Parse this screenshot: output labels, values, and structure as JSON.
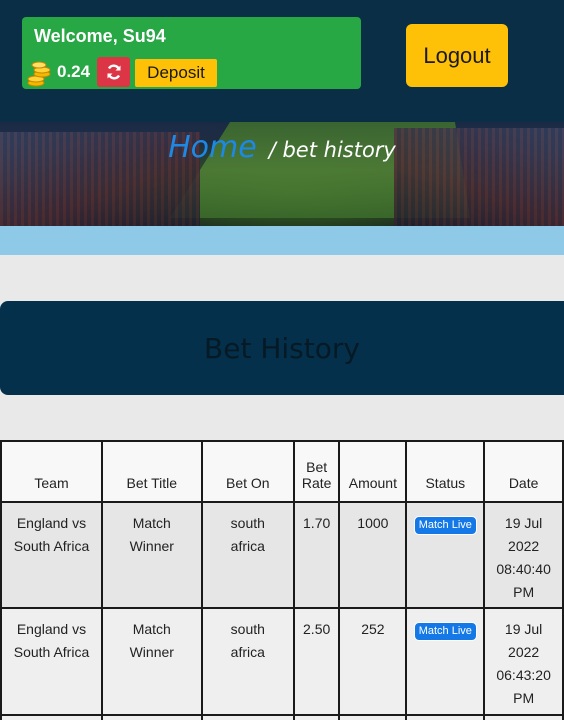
{
  "header": {
    "welcome": "Welcome, Su94",
    "balance": "0.24",
    "deposit_label": "Deposit",
    "logout_label": "Logout"
  },
  "breadcrumb": {
    "home": "Home",
    "current": "/ bet history"
  },
  "page": {
    "title": "Bet History"
  },
  "table": {
    "columns": [
      "Team",
      "Bet Title",
      "Bet On",
      "Bet Rate",
      "Amount",
      "Status",
      "Date"
    ],
    "rows": [
      {
        "team_line1": "England vs",
        "team_line2": "South Africa",
        "title_line1": "Match",
        "title_line2": "Winner",
        "on_line1": "south",
        "on_line2": "africa",
        "rate": "1.70",
        "amount": "1000",
        "status": "Match Live",
        "date_line1": "19 Jul",
        "date_line2": "2022",
        "date_line3": "08:40:40",
        "date_line4": "PM"
      },
      {
        "team_line1": "England vs",
        "team_line2": "South Africa",
        "title_line1": "Match",
        "title_line2": "Winner",
        "on_line1": "south",
        "on_line2": "africa",
        "rate": "2.50",
        "amount": "252",
        "status": "Match Live",
        "date_line1": "19 Jul",
        "date_line2": "2022",
        "date_line3": "06:43:20",
        "date_line4": "PM"
      }
    ]
  },
  "colors": {
    "header_bg": "#0a2e45",
    "welcome_bg": "#28a745",
    "accent_yellow": "#ffc107",
    "refresh_red": "#dc3545",
    "home_link": "#1e88e5",
    "status_badge": "#1479e6"
  },
  "icons": {
    "coins": "coins-icon",
    "refresh": "refresh-icon"
  }
}
